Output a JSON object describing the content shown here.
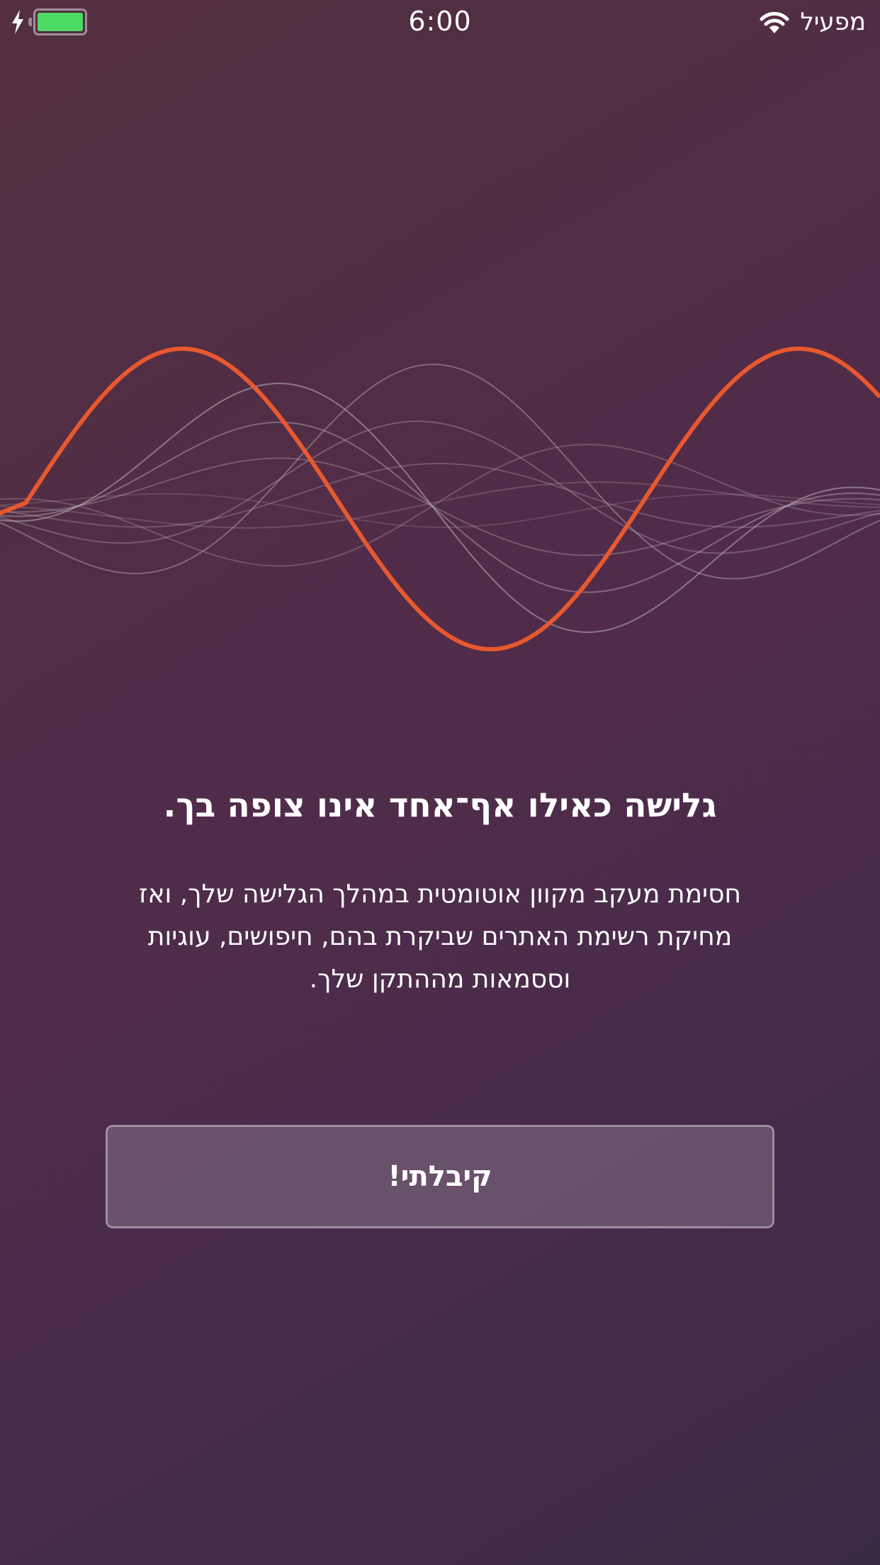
{
  "status_bar": {
    "time": "6:00",
    "carrier": "מפעיל",
    "battery_level": 1.0,
    "charging": true,
    "colors": {
      "battery": "#4cd964"
    }
  },
  "illustration": {
    "accent_color": "#e8582e",
    "line_color": "#bfb4bd"
  },
  "onboarding": {
    "headline": "גלישה כאילו אף־אחד אינו צופה בך.",
    "body": "חסימת מעקב מקוון אוטומטית במהלך הגלישה שלך, ואז מחיקת רשימת האתרים שביקרת בהם, חיפושים, עוגיות וססמאות מההתקן שלך.",
    "button_label": "קיבלתי!"
  }
}
